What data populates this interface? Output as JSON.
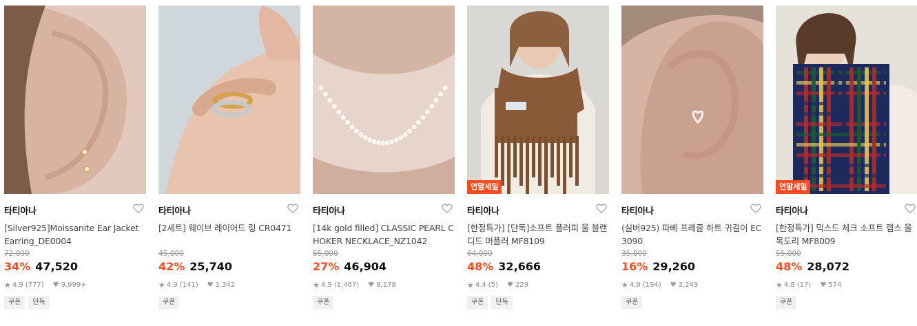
{
  "products": [
    {
      "brand": "타티아나",
      "title": "[Silver925]Moissanite Ear Jacket Earring_DE0004",
      "original_price": "72,000",
      "discount": "34%",
      "price": "47,520",
      "rating": "4.9",
      "reviews": "(777)",
      "likes": "9,999+",
      "badge": "",
      "tags": [
        "쿠폰",
        "단독"
      ],
      "image": "ear-jacket-earring-photo",
      "bg": "#e3c9bd",
      "accent": "#c8a08c"
    },
    {
      "brand": "타티아나",
      "title": "[2세트] 웨이브 레이어드 링 CR0471",
      "original_price": "45,000",
      "discount": "42%",
      "price": "25,740",
      "rating": "4.9",
      "reviews": "(141)",
      "likes": "1,342",
      "badge": "",
      "tags": [
        "쿠폰"
      ],
      "image": "layered-ring-photo",
      "bg": "#cfd7dd",
      "accent": "#e8c4ae"
    },
    {
      "brand": "타티아나",
      "title": "[14k gold filled] CLASSIC PEARL CHOKER NECKLACE_NZ1042",
      "original_price": "65,000",
      "discount": "27%",
      "price": "46,904",
      "rating": "4.9",
      "reviews": "(1,467)",
      "likes": "8,178",
      "badge": "",
      "tags": [
        "쿠폰"
      ],
      "image": "pearl-necklace-photo",
      "bg": "#e7d4ca",
      "accent": "#d8b8a7"
    },
    {
      "brand": "타티아나",
      "title": "[한정특가] [단독]소프트 플러피 울 블랜디드 머플러 MF8109",
      "original_price": "64,000",
      "discount": "48%",
      "price": "32,666",
      "rating": "4.4",
      "reviews": "(5)",
      "likes": "229",
      "badge": "연말세일",
      "tags": [
        "쿠폰",
        "단독"
      ],
      "image": "brown-muffler-photo",
      "bg": "#d9d8d5",
      "accent": "#8a5a38"
    },
    {
      "brand": "타티아나",
      "title": "(실버925) 파베 프레즐 하트 귀걸이 EC3090",
      "original_price": "35,000",
      "discount": "16%",
      "price": "29,260",
      "rating": "4.9",
      "reviews": "(194)",
      "likes": "3,249",
      "badge": "",
      "tags": [
        "쿠폰"
      ],
      "image": "heart-earring-photo",
      "bg": "#d7b3a4",
      "accent": "#c59585"
    },
    {
      "brand": "타티아나",
      "title": "[한정특가] 믹스드 체크 소프트 램스 울 목도리 MF8009",
      "original_price": "55,000",
      "discount": "48%",
      "price": "28,072",
      "rating": "4.8",
      "reviews": "(17)",
      "likes": "574",
      "badge": "연말세일",
      "tags": [
        "쿠폰"
      ],
      "image": "check-muffler-photo",
      "bg": "#e6e2da",
      "accent": "#b22a2a"
    }
  ]
}
